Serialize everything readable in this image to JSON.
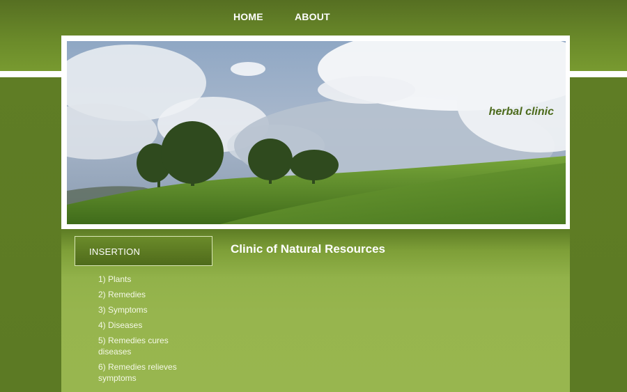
{
  "nav": {
    "home": "HOME",
    "about": "ABOUT"
  },
  "header": {
    "brand": "herbal clinic"
  },
  "sidebar": {
    "title": "INSERTION",
    "items": [
      {
        "label": "1) Plants"
      },
      {
        "label": "2) Remedies"
      },
      {
        "label": "3) Symptoms"
      },
      {
        "label": "4) Diseases"
      },
      {
        "label": "5) Remedies cures diseases"
      },
      {
        "label": "6) Remedies relieves symptoms"
      }
    ]
  },
  "main": {
    "title": "Clinic of Natural Resources"
  },
  "colors": {
    "brand_green": "#4c6a1b",
    "background_green": "#5c7a24",
    "content_green": "#98b64f"
  }
}
